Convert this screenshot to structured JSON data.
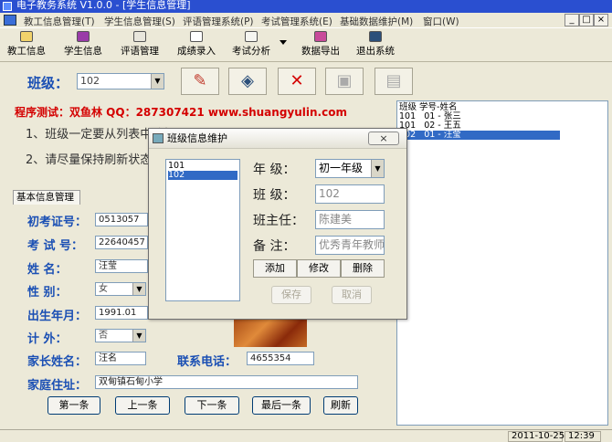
{
  "window": {
    "title": "电子教务系统 V1.0.0 - [学生信息管理]",
    "min": "_",
    "max": "□",
    "close": "×"
  },
  "menu": {
    "items": [
      "教工信息管理(T)",
      "学生信息管理(S)",
      "评语管理系统(P)",
      "考试管理系统(E)",
      "基础数据维护(M)",
      "窗口(W)"
    ]
  },
  "toolbar": {
    "items": [
      "教工信息",
      "学生信息",
      "评语管理",
      "成绩录入",
      "考试分析",
      "数据导出",
      "退出系统"
    ]
  },
  "class_selector": {
    "label": "班级：",
    "value": "102"
  },
  "promo": "程序测试：双鱼林  QQ：287307421  www.shuangyulin.com",
  "notes": [
    "1、班级一定要从列表中选择",
    "2、请尽量保持刷新状态"
  ],
  "tab": {
    "label": "基本信息管理"
  },
  "form": {
    "exam_id": {
      "label": "初考证号：",
      "value": "0513057"
    },
    "test_no": {
      "label": "考 试 号：",
      "value": "22640457"
    },
    "name": {
      "label": "姓    名：",
      "value": "汪莹"
    },
    "gender": {
      "label": "性    别：",
      "value": "女"
    },
    "birth": {
      "label": "出生年月：",
      "value": "1991.01"
    },
    "out_of_plan": {
      "label": "计    外：",
      "value": "否"
    },
    "parent": {
      "label": "家长姓名：",
      "value": "汪名"
    },
    "phone": {
      "label": "联系电话：",
      "value": "4655354"
    },
    "address": {
      "label": "家庭住址：",
      "value": "双甸镇石甸小学"
    }
  },
  "nav": {
    "first": "第一条",
    "prev": "上一条",
    "next": "下一条",
    "last": "最后一条",
    "refresh": "刷新"
  },
  "student_list": {
    "rows": [
      "班级 学号-姓名",
      "101   01 - 张三",
      "101   02 - 王五",
      "102   01 - 汪莹"
    ],
    "selected_index": 3
  },
  "status": {
    "date": "2011-10-25",
    "time": "12:39"
  },
  "dialog": {
    "title": "班级信息维护",
    "close": "×",
    "classes": [
      "101",
      "102"
    ],
    "selected_index": 1,
    "grade": {
      "label": "年   级：",
      "value": "初一年级"
    },
    "class": {
      "label": "班   级：",
      "value": "102"
    },
    "teacher": {
      "label": "班主任：",
      "value": "陈建美"
    },
    "remark": {
      "label": "备   注：",
      "value": "优秀青年教师"
    },
    "buttons": {
      "add": "添加",
      "edit": "修改",
      "delete": "删除",
      "save": "保存",
      "cancel": "取消"
    }
  }
}
